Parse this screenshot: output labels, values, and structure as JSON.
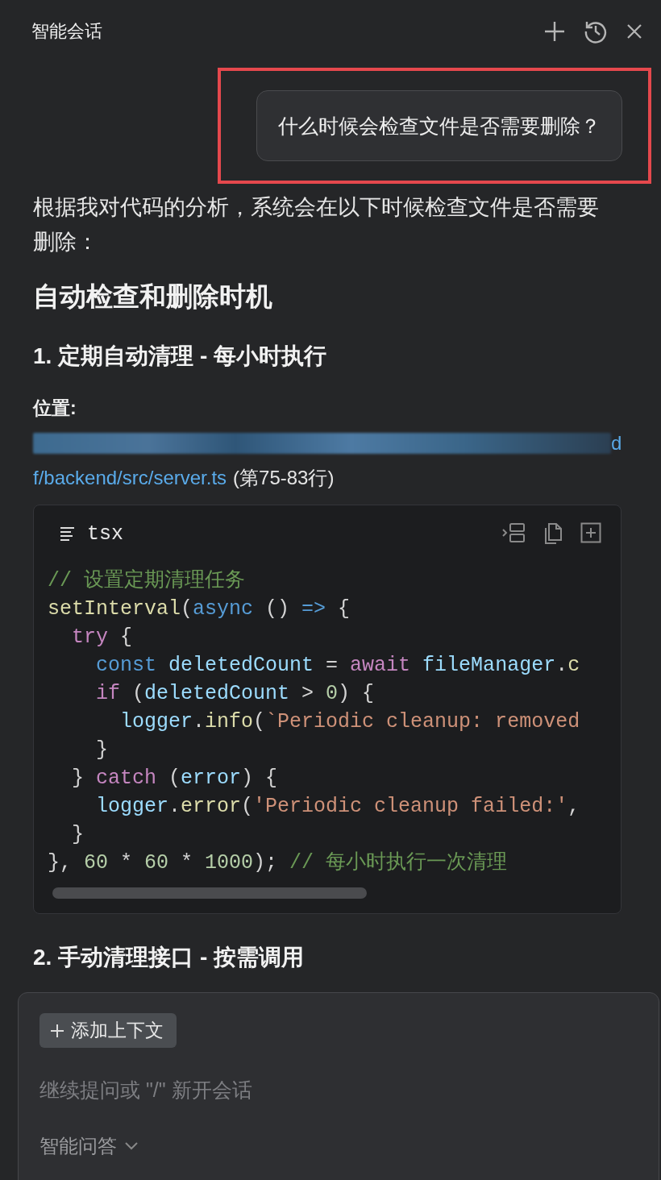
{
  "header": {
    "title": "智能会话"
  },
  "user_message": {
    "text": "什么时候会检查文件是否需要删除？",
    "highlighted": true
  },
  "answer": [
    {
      "kind": "paragraph",
      "text": "根据我对代码的分析，系统会在以下时候检查文件是否需要删除："
    },
    {
      "kind": "h2",
      "text": "自动检查和删除时机"
    },
    {
      "kind": "h3",
      "text": "1. 定期自动清理 - 每小时执行"
    },
    {
      "kind": "label",
      "text": "位置:"
    },
    {
      "kind": "location",
      "link_tail": "d",
      "link": "f/backend/src/server.ts",
      "note": "(第75-83行)"
    },
    {
      "kind": "code",
      "language": "tsx",
      "lines": [
        [
          {
            "kind": "comment",
            "text": "// 设置定期清理任务"
          }
        ],
        [
          {
            "kind": "fn",
            "text": "setInterval"
          },
          {
            "kind": "plain",
            "text": "("
          },
          {
            "kind": "keyword",
            "text": "async"
          },
          {
            "kind": "plain",
            "text": " () "
          },
          {
            "kind": "keyword",
            "text": "=>"
          },
          {
            "kind": "plain",
            "text": " {"
          }
        ],
        [
          {
            "kind": "control",
            "text": "  try"
          },
          {
            "kind": "plain",
            "text": " {"
          }
        ],
        [
          {
            "kind": "keyword",
            "text": "    const"
          },
          {
            "kind": "var",
            "text": " deletedCount"
          },
          {
            "kind": "plain",
            "text": " = "
          },
          {
            "kind": "control",
            "text": "await"
          },
          {
            "kind": "var",
            "text": " fileManager"
          },
          {
            "kind": "plain",
            "text": "."
          },
          {
            "kind": "fn",
            "text": "c"
          }
        ],
        [
          {
            "kind": "control",
            "text": "    if"
          },
          {
            "kind": "plain",
            "text": " ("
          },
          {
            "kind": "var",
            "text": "deletedCount"
          },
          {
            "kind": "plain",
            "text": " > "
          },
          {
            "kind": "number",
            "text": "0"
          },
          {
            "kind": "plain",
            "text": ") {"
          }
        ],
        [
          {
            "kind": "var",
            "text": "      logger"
          },
          {
            "kind": "plain",
            "text": "."
          },
          {
            "kind": "fn",
            "text": "info"
          },
          {
            "kind": "plain",
            "text": "("
          },
          {
            "kind": "string",
            "text": "`Periodic cleanup: removed"
          }
        ],
        [
          {
            "kind": "plain",
            "text": "    }"
          }
        ],
        [
          {
            "kind": "plain",
            "text": "  } "
          },
          {
            "kind": "control",
            "text": "catch"
          },
          {
            "kind": "plain",
            "text": " ("
          },
          {
            "kind": "var",
            "text": "error"
          },
          {
            "kind": "plain",
            "text": ") {"
          }
        ],
        [
          {
            "kind": "var",
            "text": "    logger"
          },
          {
            "kind": "plain",
            "text": "."
          },
          {
            "kind": "fn",
            "text": "error"
          },
          {
            "kind": "plain",
            "text": "("
          },
          {
            "kind": "string",
            "text": "'Periodic cleanup failed:'"
          },
          {
            "kind": "plain",
            "text": ","
          }
        ],
        [
          {
            "kind": "plain",
            "text": "  }"
          }
        ],
        [
          {
            "kind": "plain",
            "text": "}, "
          },
          {
            "kind": "number",
            "text": "60"
          },
          {
            "kind": "plain",
            "text": " * "
          },
          {
            "kind": "number",
            "text": "60"
          },
          {
            "kind": "plain",
            "text": " * "
          },
          {
            "kind": "number",
            "text": "1000"
          },
          {
            "kind": "plain",
            "text": "); "
          },
          {
            "kind": "comment",
            "text": "// 每小时执行一次清理"
          }
        ]
      ]
    },
    {
      "kind": "h3",
      "text": "2. 手动清理接口 - 按需调用"
    }
  ],
  "input": {
    "context_button": "添加上下文",
    "placeholder": "继续提问或 \"/\" 新开会话",
    "mode": "智能问答"
  }
}
